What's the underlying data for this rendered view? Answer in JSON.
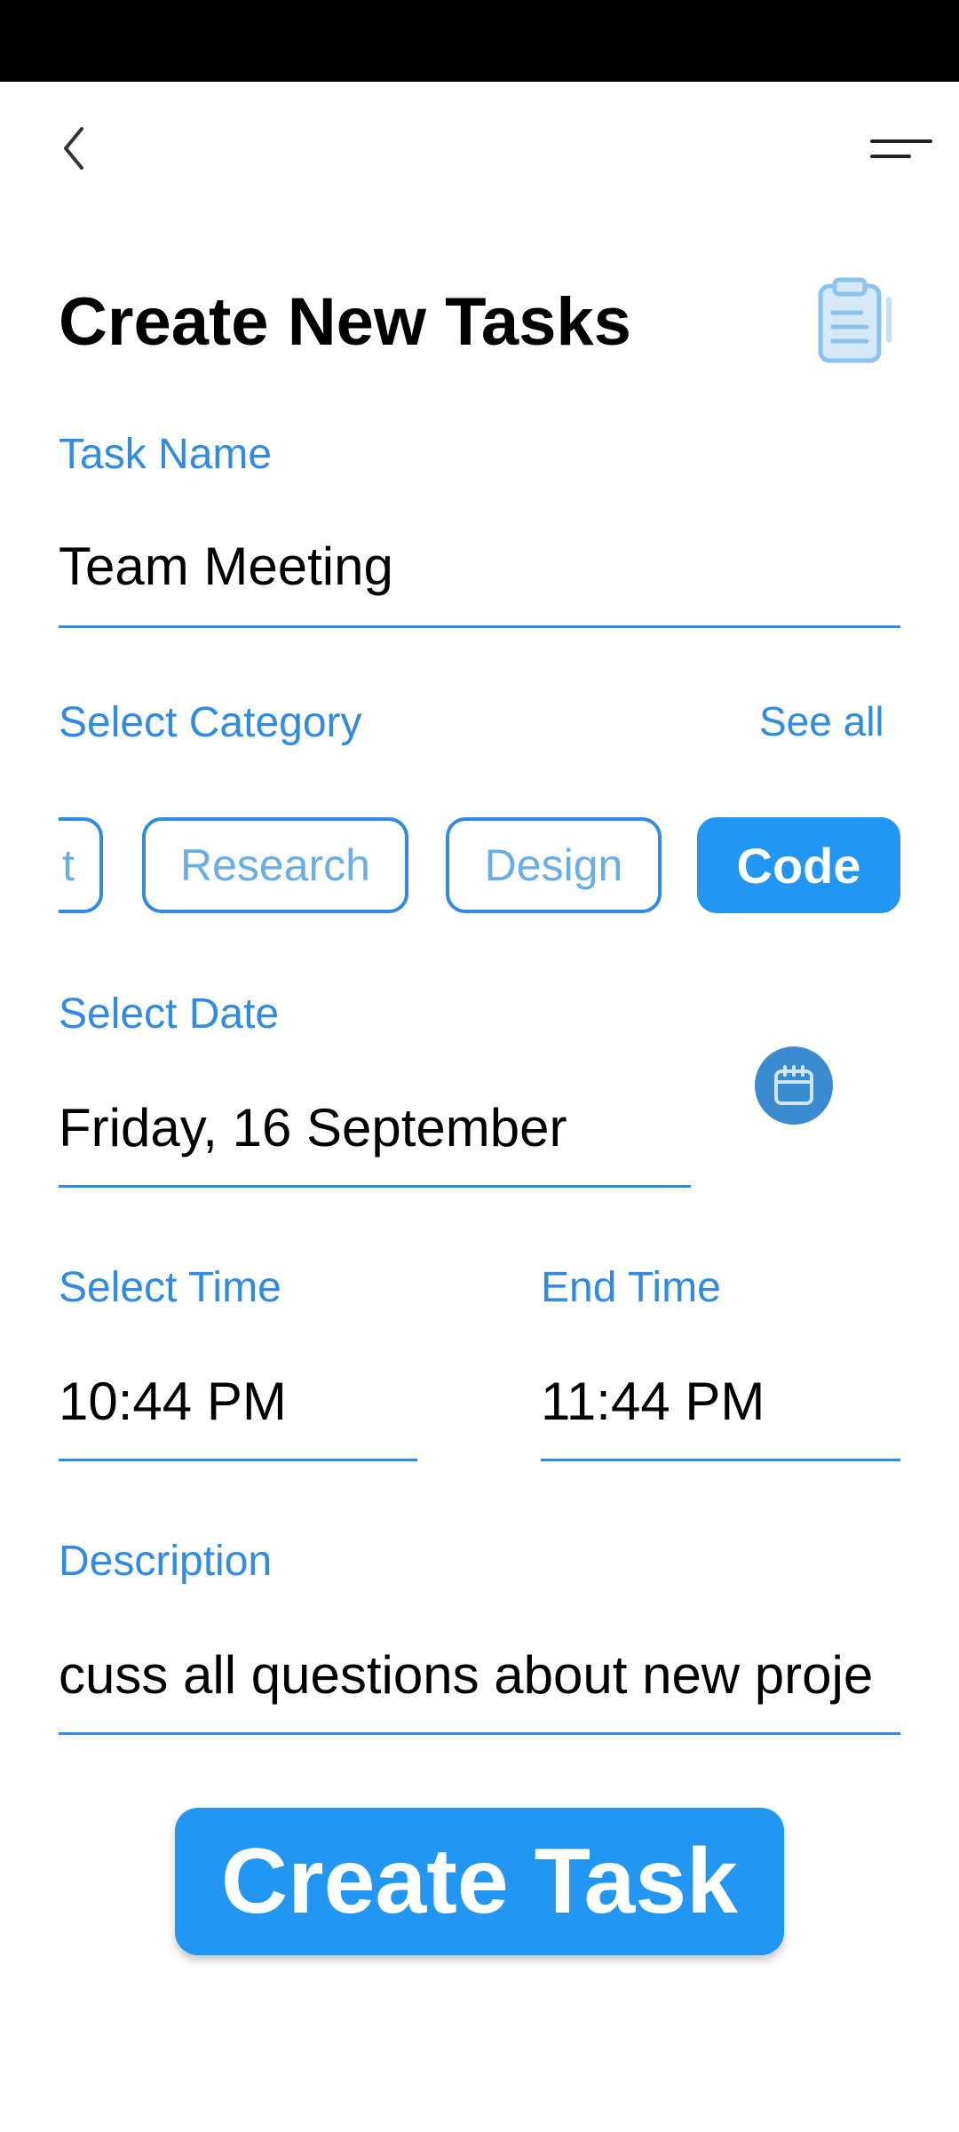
{
  "header": {
    "title": "Create New Tasks",
    "back_icon": "chevron-left-icon",
    "menu_icon": "menu-lines-icon",
    "clipboard_icon": "clipboard-icon"
  },
  "task_name": {
    "label": "Task Name",
    "value": "Team Meeting"
  },
  "category": {
    "label": "Select Category",
    "see_all": "See all",
    "chips": [
      {
        "label": "t",
        "selected": false
      },
      {
        "label": "Research",
        "selected": false
      },
      {
        "label": "Design",
        "selected": false
      },
      {
        "label": "Code",
        "selected": true
      }
    ]
  },
  "date": {
    "label": "Select Date",
    "value": "Friday, 16 September",
    "icon": "calendar-icon"
  },
  "start_time": {
    "label": "Select Time",
    "value": "10:44 PM"
  },
  "end_time": {
    "label": "End Time",
    "value": "11:44 PM"
  },
  "description": {
    "label": "Description",
    "value": "cuss all questions about new proje"
  },
  "submit": {
    "label": "Create Task"
  },
  "colors": {
    "accent": "#2196f3",
    "label": "#2f8be3",
    "chip_text": "#6aaee6"
  }
}
